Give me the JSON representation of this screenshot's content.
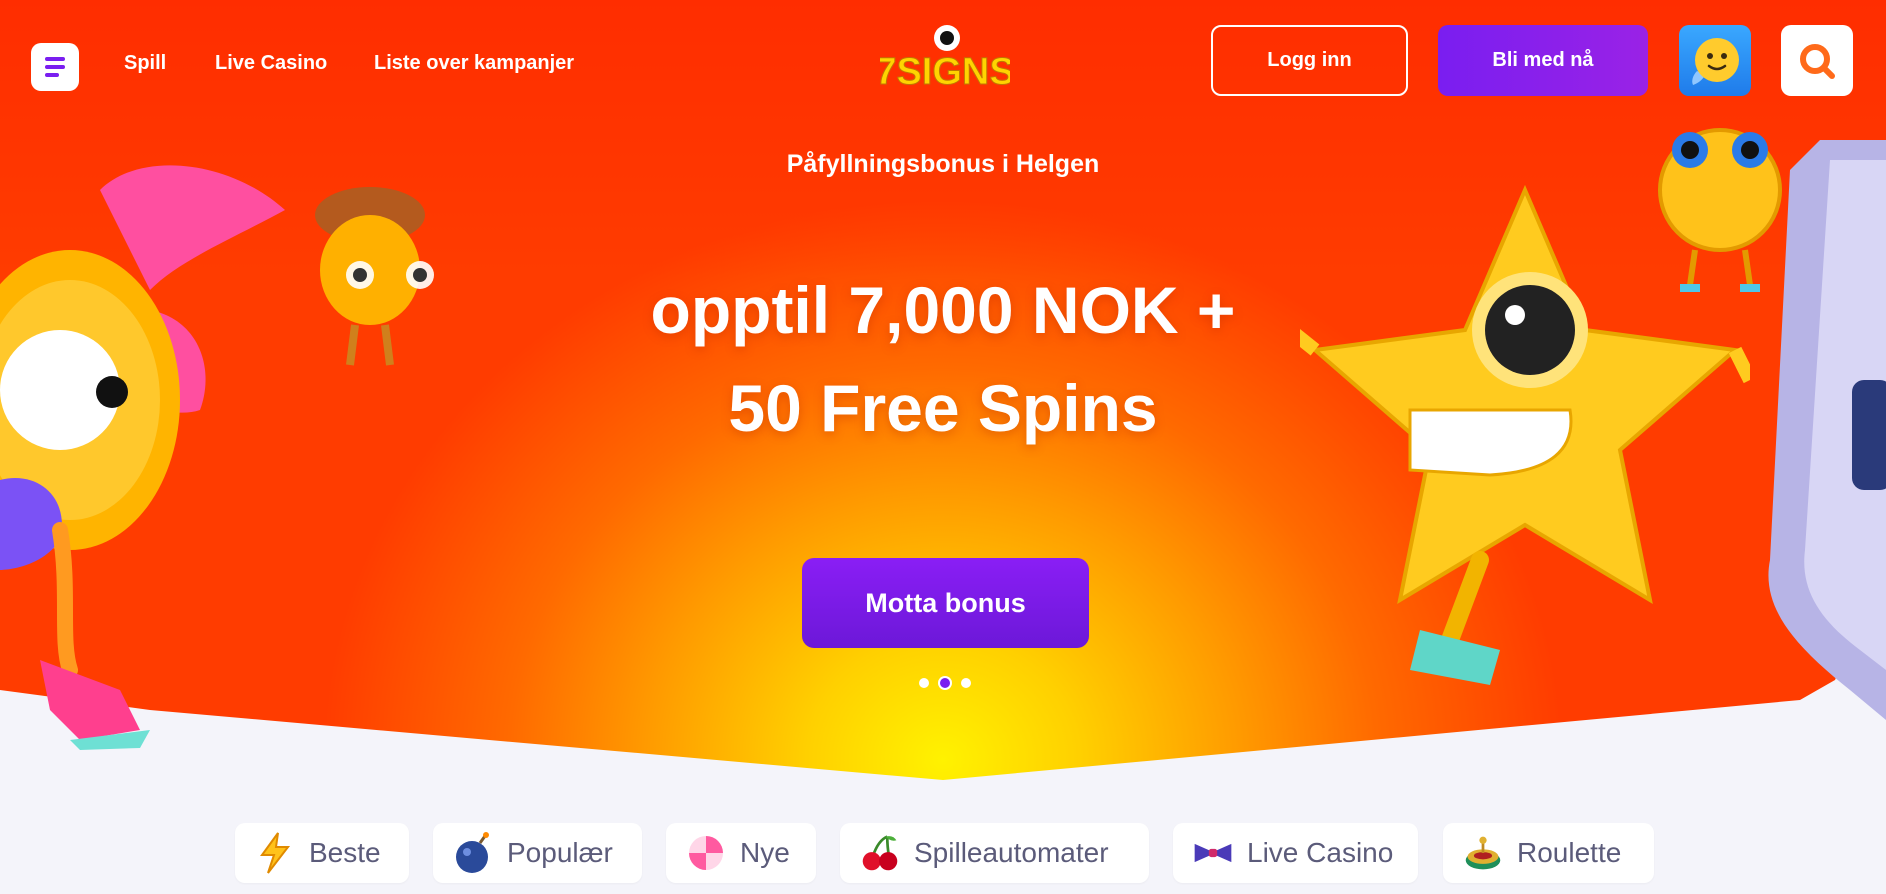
{
  "header": {
    "nav": [
      "Spill",
      "Live Casino",
      "Liste over kampanjer"
    ],
    "logo_text": "7SIGNS",
    "login_label": "Logg inn",
    "join_label": "Bli med nå",
    "icons": {
      "menu": "menu-icon",
      "chat": "chat-smiley-icon",
      "search": "search-icon"
    }
  },
  "hero": {
    "subtitle": "Påfyllningsbonus i Helgen",
    "title_line1": "opptil 7,000 NOK +",
    "title_line2": "50 Free Spins",
    "cta_label": "Motta bonus",
    "slides_count": 3,
    "active_slide": 2
  },
  "categories": [
    {
      "label": "Beste",
      "icon": "lightning-icon"
    },
    {
      "label": "Populær",
      "icon": "bomb-icon"
    },
    {
      "label": "Nye",
      "icon": "candy-icon"
    },
    {
      "label": "Spilleautomater",
      "icon": "cherries-icon"
    },
    {
      "label": "Live Casino",
      "icon": "bowtie-icon"
    },
    {
      "label": "Roulette",
      "icon": "roulette-icon"
    }
  ],
  "colors": {
    "accent_purple": "#7a1ef0",
    "hero_orange": "#ff5a00",
    "hero_yellow": "#fff200",
    "logo_yellow": "#ffd400"
  }
}
